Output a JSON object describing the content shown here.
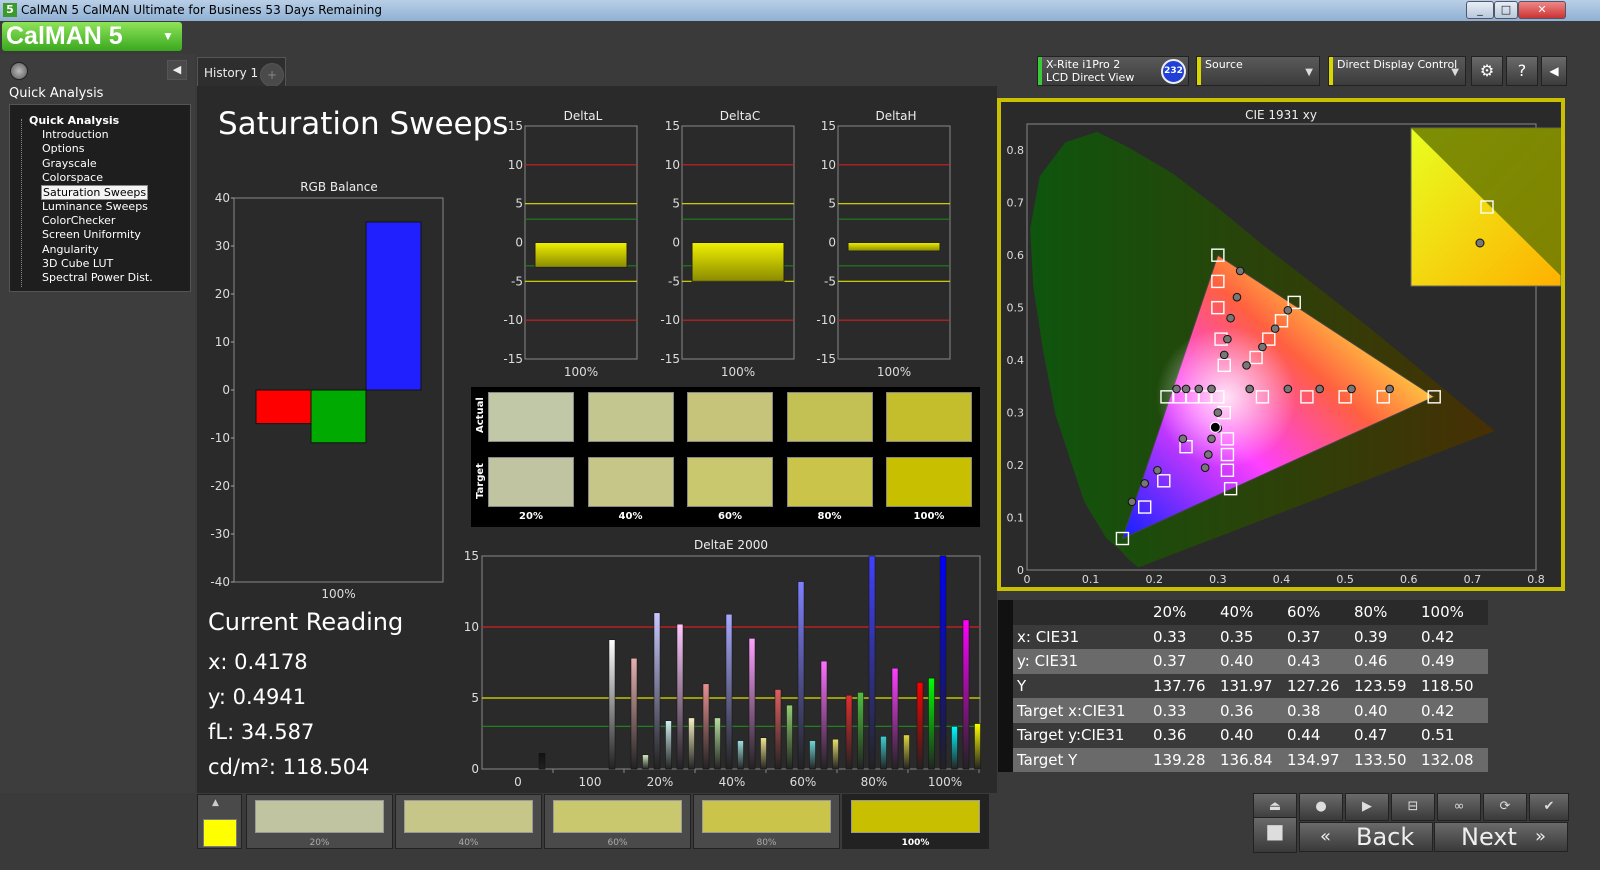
{
  "window": {
    "title": "CalMAN 5 CalMAN Ultimate for Business 53 Days Remaining",
    "icon_text": "5"
  },
  "app": {
    "logo": "CalMAN 5"
  },
  "sidebar": {
    "title": "Quick Analysis",
    "tree_root": "Quick Analysis",
    "items": [
      {
        "label": "Introduction"
      },
      {
        "label": "Options"
      },
      {
        "label": "Grayscale"
      },
      {
        "label": "Colorspace"
      },
      {
        "label": "Saturation Sweeps"
      },
      {
        "label": "Luminance Sweeps"
      },
      {
        "label": "ColorChecker"
      },
      {
        "label": "Screen Uniformity"
      },
      {
        "label": "Angularity"
      },
      {
        "label": "3D Cube LUT"
      },
      {
        "label": "Spectral Power Dist."
      }
    ],
    "selected": "Saturation Sweeps"
  },
  "tabs": [
    {
      "label": "History 1"
    }
  ],
  "toolbar": {
    "meter": {
      "line1": "X-Rite i1Pro 2",
      "line2": "LCD Direct View",
      "accent": "#3cc83c"
    },
    "badge": "232",
    "source": {
      "label": "Source",
      "accent": "#d8d800"
    },
    "display": {
      "label": "Direct Display Control",
      "accent": "#d8d800"
    }
  },
  "page": {
    "title": "Saturation Sweeps"
  },
  "current_reading": {
    "title": "Current Reading",
    "x": "x: 0.4178",
    "y": "y: 0.4941",
    "fl": "fL: 34.587",
    "cdm2": "cd/m²: 118.504"
  },
  "swatch_panel": {
    "row_labels": [
      "Actual",
      "Target"
    ],
    "columns": [
      "20%",
      "40%",
      "60%",
      "80%",
      "100%"
    ],
    "actual_colors": [
      "#c0c8a8",
      "#c4c690",
      "#c6c47a",
      "#c4c154",
      "#c4bd2c"
    ],
    "target_colors": [
      "#c0c4a0",
      "#c6c688",
      "#c9c86e",
      "#cac54a",
      "#c8bf00"
    ]
  },
  "chart_data": [
    {
      "type": "bar",
      "title": "RGB Balance",
      "categories": [
        "100%"
      ],
      "series": [
        {
          "values": [
            -7
          ],
          "color": "#ff0000"
        },
        {
          "values": [
            -11
          ],
          "color": "#00aa00"
        },
        {
          "values": [
            35
          ],
          "color": "#2020ff"
        }
      ],
      "ylim": [
        -40,
        40
      ],
      "yticks": [
        40,
        30,
        20,
        10,
        0,
        -10,
        -20,
        -30,
        -40
      ]
    },
    {
      "type": "bar",
      "title": "DeltaL",
      "categories": [
        "100%"
      ],
      "values": [
        -3.2
      ],
      "ylim": [
        -15,
        15
      ],
      "yticks": [
        15,
        10,
        5,
        0,
        -5,
        -10,
        -15
      ]
    },
    {
      "type": "bar",
      "title": "DeltaC",
      "categories": [
        "100%"
      ],
      "values": [
        -5
      ],
      "ylim": [
        -15,
        15
      ],
      "yticks": [
        15,
        10,
        5,
        0,
        -5,
        -10,
        -15
      ]
    },
    {
      "type": "bar",
      "title": "DeltaH",
      "categories": [
        "100%"
      ],
      "values": [
        -1.1
      ],
      "ylim": [
        -15,
        15
      ],
      "yticks": [
        15,
        10,
        5,
        0,
        -5,
        -10,
        -15
      ]
    },
    {
      "type": "bar",
      "title": "DeltaE 2000",
      "categories": [
        "0",
        "100",
        "20%",
        "40%",
        "60%",
        "80%",
        "100%"
      ],
      "ylim": [
        0,
        15
      ],
      "yticks": [
        15,
        10,
        5,
        0
      ],
      "groups": [
        {
          "category": "0",
          "bars": [
            {
              "value": 1.1,
              "color": "#111111"
            }
          ]
        },
        {
          "category": "100",
          "bars": [
            {
              "value": 9.1,
              "color": "#ffffff"
            }
          ]
        },
        {
          "category": "20%",
          "bars": [
            {
              "value": 7.8,
              "color": "#e8b0b0"
            },
            {
              "value": 1.0,
              "color": "#d8f0c0"
            },
            {
              "value": 11.0,
              "color": "#c8c8ff"
            },
            {
              "value": 3.4,
              "color": "#d0f0f0"
            },
            {
              "value": 10.2,
              "color": "#ffc8ff"
            },
            {
              "value": 3.6,
              "color": "#f4f0c0"
            }
          ]
        },
        {
          "category": "40%",
          "bars": [
            {
              "value": 6.0,
              "color": "#e89090"
            },
            {
              "value": 3.6,
              "color": "#b8e0a0"
            },
            {
              "value": 10.9,
              "color": "#a8a8ff"
            },
            {
              "value": 2.0,
              "color": "#a0e0e0"
            },
            {
              "value": 9.2,
              "color": "#ffa0ff"
            },
            {
              "value": 2.2,
              "color": "#f0e890"
            }
          ]
        },
        {
          "category": "60%",
          "bars": [
            {
              "value": 5.6,
              "color": "#e06060"
            },
            {
              "value": 4.5,
              "color": "#90d070"
            },
            {
              "value": 13.2,
              "color": "#8080ff"
            },
            {
              "value": 2.0,
              "color": "#70d8d8"
            },
            {
              "value": 7.6,
              "color": "#ff70ff"
            },
            {
              "value": 2.1,
              "color": "#e8e070"
            }
          ]
        },
        {
          "category": "80%",
          "bars": [
            {
              "value": 5.2,
              "color": "#e03030"
            },
            {
              "value": 5.4,
              "color": "#50c040"
            },
            {
              "value": 15.0,
              "color": "#4040ff"
            },
            {
              "value": 2.3,
              "color": "#40d0d0"
            },
            {
              "value": 7.1,
              "color": "#ff40ff"
            },
            {
              "value": 2.4,
              "color": "#e0d840"
            }
          ]
        },
        {
          "category": "100%",
          "bars": [
            {
              "value": 6.1,
              "color": "#ff0000"
            },
            {
              "value": 6.4,
              "color": "#00ff00"
            },
            {
              "value": 15.0,
              "color": "#0000ff"
            },
            {
              "value": 3.0,
              "color": "#00ffff"
            },
            {
              "value": 10.5,
              "color": "#ff00ff"
            },
            {
              "value": 3.2,
              "color": "#ffff00"
            }
          ]
        }
      ]
    },
    {
      "type": "scatter",
      "title": "CIE 1931 xy",
      "xlim": [
        0,
        0.8
      ],
      "ylim": [
        0,
        0.85
      ],
      "xticks": [
        0,
        0.1,
        0.2,
        0.3,
        0.4,
        0.5,
        0.6,
        0.7,
        0.8
      ],
      "yticks": [
        0.8,
        0.7,
        0.6,
        0.5,
        0.4,
        0.3,
        0.2,
        0.1,
        0
      ],
      "gamut_triangle": [
        [
          0.64,
          0.33
        ],
        [
          0.3,
          0.6
        ],
        [
          0.15,
          0.06
        ]
      ],
      "white_point": [
        0.3127,
        0.329
      ],
      "target_points": [
        [
          0.3,
          0.6
        ],
        [
          0.3,
          0.55
        ],
        [
          0.3,
          0.5
        ],
        [
          0.305,
          0.44
        ],
        [
          0.31,
          0.39
        ],
        [
          0.37,
          0.33
        ],
        [
          0.44,
          0.33
        ],
        [
          0.5,
          0.33
        ],
        [
          0.56,
          0.33
        ],
        [
          0.64,
          0.33
        ],
        [
          0.25,
          0.235
        ],
        [
          0.215,
          0.17
        ],
        [
          0.185,
          0.12
        ],
        [
          0.15,
          0.06
        ],
        [
          0.31,
          0.3
        ],
        [
          0.315,
          0.25
        ],
        [
          0.315,
          0.22
        ],
        [
          0.315,
          0.19
        ],
        [
          0.32,
          0.155
        ],
        [
          0.22,
          0.33
        ],
        [
          0.24,
          0.33
        ],
        [
          0.26,
          0.33
        ],
        [
          0.28,
          0.33
        ],
        [
          0.3,
          0.33
        ],
        [
          0.42,
          0.51
        ],
        [
          0.4,
          0.475
        ],
        [
          0.38,
          0.44
        ],
        [
          0.36,
          0.405
        ]
      ],
      "measured_points": [
        [
          0.335,
          0.57
        ],
        [
          0.33,
          0.52
        ],
        [
          0.32,
          0.48
        ],
        [
          0.315,
          0.44
        ],
        [
          0.31,
          0.41
        ],
        [
          0.35,
          0.345
        ],
        [
          0.41,
          0.345
        ],
        [
          0.46,
          0.345
        ],
        [
          0.51,
          0.345
        ],
        [
          0.57,
          0.345
        ],
        [
          0.245,
          0.25
        ],
        [
          0.205,
          0.19
        ],
        [
          0.185,
          0.165
        ],
        [
          0.165,
          0.13
        ],
        [
          0.3,
          0.3
        ],
        [
          0.29,
          0.25
        ],
        [
          0.285,
          0.22
        ],
        [
          0.28,
          0.195
        ],
        [
          0.29,
          0.345
        ],
        [
          0.27,
          0.345
        ],
        [
          0.25,
          0.345
        ],
        [
          0.235,
          0.345
        ],
        [
          0.41,
          0.495
        ],
        [
          0.39,
          0.46
        ],
        [
          0.37,
          0.425
        ],
        [
          0.345,
          0.39
        ],
        [
          0.3,
          0.27
        ]
      ],
      "current_point": [
        0.296,
        0.272
      ],
      "inset": {
        "target": [
          0.42,
          0.51
        ],
        "measured": [
          0.4178,
          0.4941
        ]
      }
    }
  ],
  "table": {
    "headers": [
      "20%",
      "40%",
      "60%",
      "80%",
      "100%"
    ],
    "rows": [
      {
        "label": "x: CIE31",
        "values": [
          "0.33",
          "0.35",
          "0.37",
          "0.39",
          "0.42"
        ]
      },
      {
        "label": "y: CIE31",
        "values": [
          "0.37",
          "0.40",
          "0.43",
          "0.46",
          "0.49"
        ]
      },
      {
        "label": "Y",
        "values": [
          "137.76",
          "131.97",
          "127.26",
          "123.59",
          "118.50"
        ]
      },
      {
        "label": "Target x:CIE31",
        "values": [
          "0.33",
          "0.36",
          "0.38",
          "0.40",
          "0.42"
        ]
      },
      {
        "label": "Target y:CIE31",
        "values": [
          "0.36",
          "0.40",
          "0.44",
          "0.47",
          "0.51"
        ]
      },
      {
        "label": "Target Y",
        "values": [
          "139.28",
          "136.84",
          "134.97",
          "133.50",
          "132.08"
        ]
      }
    ]
  },
  "bottom_strip": {
    "current_color": "#ffff00",
    "swatches": [
      {
        "label": "20%",
        "color": "#c0c4a0"
      },
      {
        "label": "40%",
        "color": "#c6c688"
      },
      {
        "label": "60%",
        "color": "#c9c86e"
      },
      {
        "label": "80%",
        "color": "#cac54a"
      },
      {
        "label": "100%",
        "color": "#c8bf00"
      }
    ],
    "active": "100%"
  },
  "nav": {
    "back": "Back",
    "next": "Next"
  }
}
